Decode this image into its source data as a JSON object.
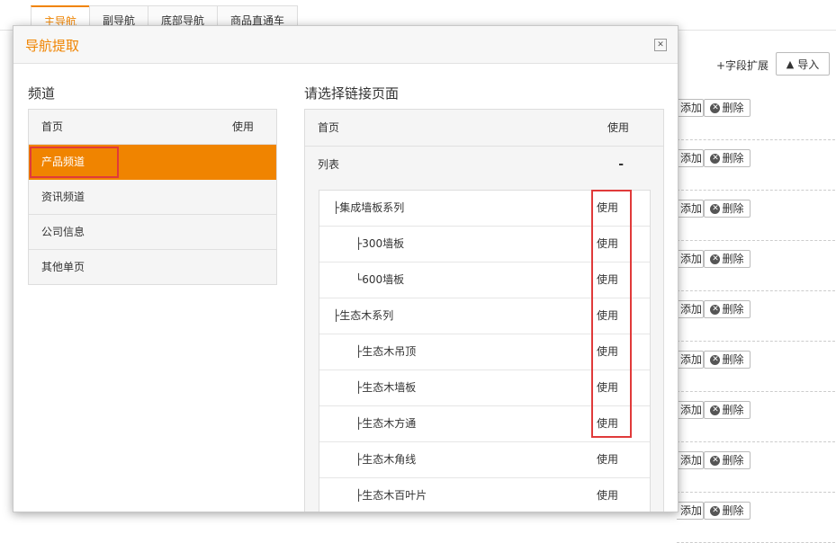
{
  "background": {
    "tabs": [
      {
        "label": "主导航",
        "active": true
      },
      {
        "label": "副导航",
        "active": false
      },
      {
        "label": "底部导航",
        "active": false
      },
      {
        "label": "商品直通车",
        "active": false
      }
    ],
    "field_ext_label": "+字段扩展",
    "import_label": "导入",
    "add_label": "添加",
    "delete_label": "删除"
  },
  "modal": {
    "title": "导航提取",
    "channel_heading": "频道",
    "page_heading": "请选择链接页面",
    "channels": [
      {
        "label": "首页",
        "use": "使用"
      },
      {
        "label": "产品频道",
        "use": ""
      },
      {
        "label": "资讯频道",
        "use": ""
      },
      {
        "label": "公司信息",
        "use": ""
      },
      {
        "label": "其他单页",
        "use": ""
      }
    ],
    "pages_top": [
      {
        "label": "首页",
        "action": "使用"
      },
      {
        "label": "列表",
        "action": "-"
      }
    ],
    "sub_pages": [
      {
        "label": "├集成墙板系列",
        "use": "使用"
      },
      {
        "label": "├300墙板",
        "use": "使用"
      },
      {
        "label": "└600墙板",
        "use": "使用"
      },
      {
        "label": "├生态木系列",
        "use": "使用"
      },
      {
        "label": "├生态木吊顶",
        "use": "使用"
      },
      {
        "label": "├生态木墙板",
        "use": "使用"
      },
      {
        "label": "├生态木方通",
        "use": "使用"
      },
      {
        "label": "├生态木角线",
        "use": "使用"
      },
      {
        "label": "├生态木百叶片",
        "use": "使用"
      }
    ]
  },
  "colors": {
    "accent": "#f08400",
    "highlight": "#e03a3a"
  }
}
